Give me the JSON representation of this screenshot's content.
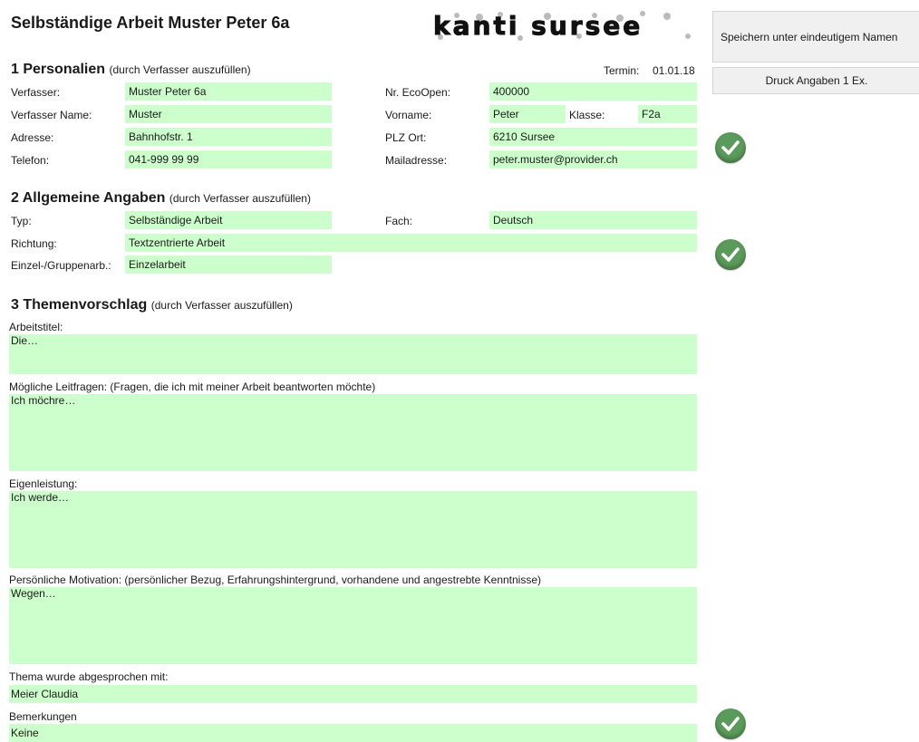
{
  "title": "Selbständige Arbeit Muster Peter 6a",
  "logo": {
    "text": "kanti sursee"
  },
  "buttons": {
    "save_label": "Speichern unter eindeutigem Namen",
    "print_label": "Druck Angaben 1 Ex."
  },
  "section1": {
    "heading": "1 Personalien",
    "sub": "(durch Verfasser auszufüllen)",
    "termin_label": "Termin:",
    "termin_value": "01.01.18",
    "verfasser_label": "Verfasser:",
    "verfasser_value": "Muster Peter 6a",
    "verfasser_name_label": "Verfasser Name:",
    "verfasser_name_value": "Muster",
    "adresse_label": "Adresse:",
    "adresse_value": "Bahnhofstr. 1",
    "telefon_label": "Telefon:",
    "telefon_value": "041-999 99 99",
    "ecoopen_label": "Nr. EcoOpen:",
    "ecoopen_value": "400000",
    "vorname_label": "Vorname:",
    "vorname_value": "Peter",
    "klasse_label": "Klasse:",
    "klasse_value": "F2a",
    "plz_label": "PLZ Ort:",
    "plz_value": "6210 Sursee",
    "mail_label": "Mailadresse:",
    "mail_value": "peter.muster@provider.ch"
  },
  "section2": {
    "heading": "2 Allgemeine Angaben",
    "sub": "(durch Verfasser auszufüllen)",
    "typ_label": "Typ:",
    "typ_value": "Selbständige Arbeit",
    "fach_label": "Fach:",
    "fach_value": "Deutsch",
    "richtung_label": "Richtung:",
    "richtung_value": "Textzentrierte Arbeit",
    "einzel_label": "Einzel-/Gruppenarb.:",
    "einzel_value": "Einzelarbeit"
  },
  "section3": {
    "heading": "3 Themenvorschlag",
    "sub": "(durch Verfasser auszufüllen)",
    "arbeitstitel_label": "Arbeitstitel:",
    "arbeitstitel_value": "Die…",
    "leitfragen_label": "Mögliche Leitfragen: (Fragen, die ich mit meiner Arbeit beantworten möchte)",
    "leitfragen_value": "Ich möchre…",
    "eigenleistung_label": "Eigenleistung:",
    "eigenleistung_value": "Ich werde…",
    "motivation_label": "Persönliche Motivation: (persönlicher Bezug, Erfahrungshintergrund, vorhandene und angestrebte Kenntnisse)",
    "motivation_value": "Wegen…",
    "thema_label": "Thema wurde abgesprochen mit:",
    "thema_value": "Meier Claudia",
    "bemerkungen_label": "Bemerkungen",
    "bemerkungen_value": "Keine"
  },
  "icons": [
    "checkmark-icon",
    "checkmark-icon",
    "checkmark-icon"
  ],
  "colors": {
    "field_bg": "#ccffcc",
    "check_green": "#5a9a5a"
  }
}
